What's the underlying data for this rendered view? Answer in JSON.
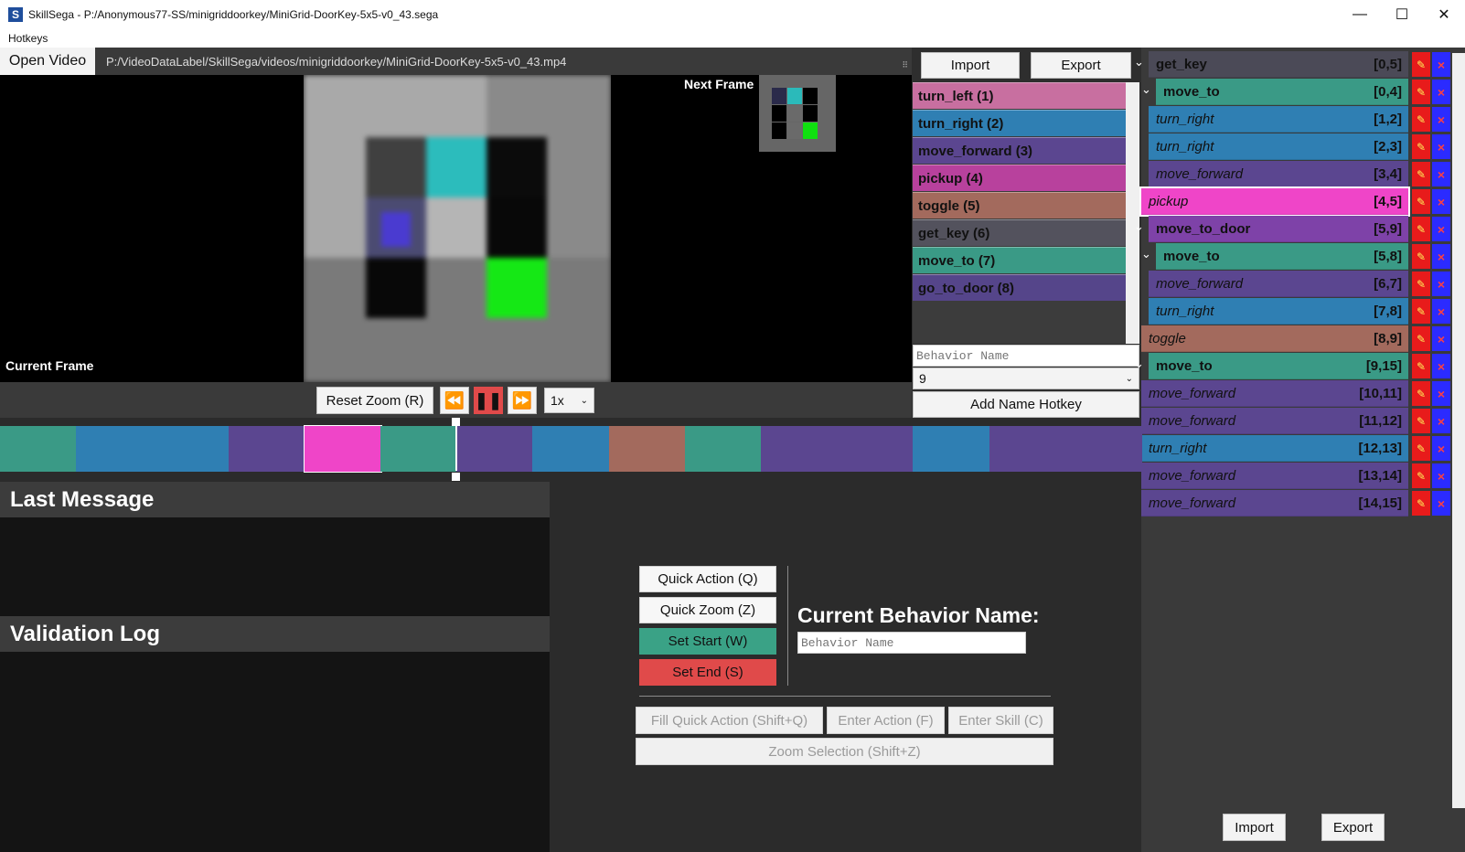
{
  "window": {
    "title": "SkillSega - P:/Anonymous77-SS/minigriddoorkey/MiniGrid-DoorKey-5x5-v0_43.sega",
    "icon_letter": "S",
    "menu": "Hotkeys"
  },
  "video": {
    "open_label": "Open Video",
    "path": "P:/VideoDataLabel/SkillSega/videos/minigriddoorkey/MiniGrid-DoorKey-5x5-v0_43.mp4",
    "current_label": "Current Frame",
    "next_label": "Next Frame"
  },
  "playback": {
    "reset_zoom": "Reset Zoom (R)",
    "speed": "1x"
  },
  "behaviors": {
    "import": "Import",
    "export": "Export",
    "items": [
      {
        "label": "turn_left (1)",
        "color": "#c86fa0"
      },
      {
        "label": "turn_right (2)",
        "color": "#2f7fb3"
      },
      {
        "label": "move_forward (3)",
        "color": "#5b4690"
      },
      {
        "label": "pickup (4)",
        "color": "#b8419d"
      },
      {
        "label": "toggle (5)",
        "color": "#a36a5d"
      },
      {
        "label": "get_key (6)",
        "color": "#53525d"
      },
      {
        "label": "move_to (7)",
        "color": "#3a9a86"
      },
      {
        "label": "go_to_door (8)",
        "color": "#55458a"
      }
    ],
    "name_placeholder": "Behavior Name",
    "hotkey_value": "9",
    "add_hotkey": "Add Name Hotkey"
  },
  "tree": {
    "rows": [
      {
        "label": "get_key",
        "range": "[0,5]",
        "color": "#4b4a57",
        "bold": true,
        "italic": false,
        "indent": 0,
        "chev": true
      },
      {
        "label": "move_to",
        "range": "[0,4]",
        "color": "#3a9a86",
        "bold": true,
        "italic": false,
        "indent": 8,
        "chev": true
      },
      {
        "label": "turn_right",
        "range": "[1,2]",
        "color": "#2f7fb3",
        "bold": false,
        "italic": true,
        "indent": 0,
        "chev": false
      },
      {
        "label": "turn_right",
        "range": "[2,3]",
        "color": "#2f7fb3",
        "bold": false,
        "italic": true,
        "indent": 0,
        "chev": false
      },
      {
        "label": "move_forward",
        "range": "[3,4]",
        "color": "#5b4690",
        "bold": false,
        "italic": true,
        "indent": 0,
        "chev": false
      },
      {
        "label": "pickup",
        "range": "[4,5]",
        "color": "#ef45c8",
        "bold": false,
        "italic": true,
        "indent": -8,
        "chev": false
      },
      {
        "label": "move_to_door",
        "range": "[5,9]",
        "color": "#7e42a8",
        "bold": true,
        "italic": false,
        "indent": 0,
        "chev": true
      },
      {
        "label": "move_to",
        "range": "[5,8]",
        "color": "#3a9a86",
        "bold": true,
        "italic": false,
        "indent": 8,
        "chev": true
      },
      {
        "label": "move_forward",
        "range": "[6,7]",
        "color": "#5b4690",
        "bold": false,
        "italic": true,
        "indent": 0,
        "chev": false
      },
      {
        "label": "turn_right",
        "range": "[7,8]",
        "color": "#2f7fb3",
        "bold": false,
        "italic": true,
        "indent": 0,
        "chev": false
      },
      {
        "label": "toggle",
        "range": "[8,9]",
        "color": "#a36a5d",
        "bold": false,
        "italic": true,
        "indent": -8,
        "chev": false
      },
      {
        "label": "move_to",
        "range": "[9,15]",
        "color": "#3a9a86",
        "bold": true,
        "italic": false,
        "indent": 0,
        "chev": true
      },
      {
        "label": "move_forward",
        "range": "[10,11]",
        "color": "#5b4690",
        "bold": false,
        "italic": true,
        "indent": -8,
        "chev": false
      },
      {
        "label": "move_forward",
        "range": "[11,12]",
        "color": "#5b4690",
        "bold": false,
        "italic": true,
        "indent": -8,
        "chev": false
      },
      {
        "label": "turn_right",
        "range": "[12,13]",
        "color": "#2f7fb3",
        "bold": false,
        "italic": true,
        "indent": -8,
        "chev": false
      },
      {
        "label": "move_forward",
        "range": "[13,14]",
        "color": "#5b4690",
        "bold": false,
        "italic": true,
        "indent": -8,
        "chev": false
      },
      {
        "label": "move_forward",
        "range": "[14,15]",
        "color": "#5b4690",
        "bold": false,
        "italic": true,
        "indent": -8,
        "chev": false
      }
    ],
    "import": "Import",
    "export": "Export"
  },
  "timeline": {
    "segments": [
      "#3a9a86",
      "#2f7fb3",
      "#2f7fb3",
      "#5b4690",
      "#ef45c8",
      "#3a9a86",
      "#5b4690",
      "#2f7fb3",
      "#a36a5d",
      "#3a9a86",
      "#5b4690",
      "#5b4690",
      "#2f7fb3",
      "#5b4690",
      "#5b4690"
    ]
  },
  "messages": {
    "last": "Last Message",
    "validation": "Validation Log"
  },
  "controls": {
    "quick_action": "Quick Action (Q)",
    "quick_zoom": "Quick Zoom (Z)",
    "set_start": "Set Start (W)",
    "set_end": "Set End (S)",
    "current_behavior_title": "Current Behavior Name:",
    "current_behavior_placeholder": "Behavior Name",
    "fill_quick": "Fill Quick Action (Shift+Q)",
    "enter_action": "Enter Action (F)",
    "enter_skill": "Enter Skill (C)",
    "zoom_selection": "Zoom Selection (Shift+Z)"
  }
}
